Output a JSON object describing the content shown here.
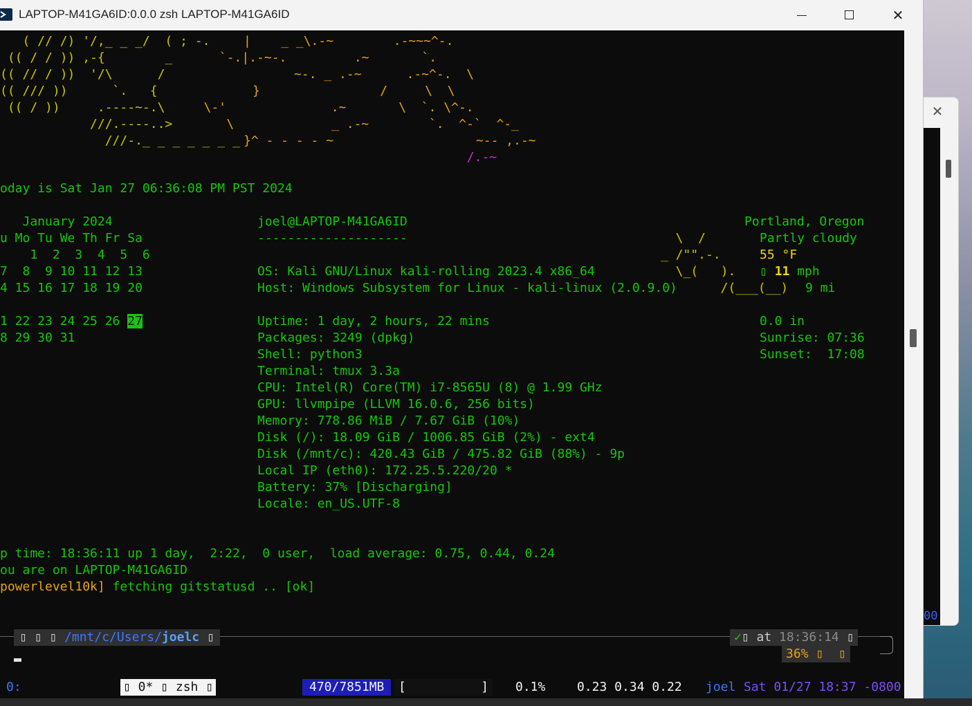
{
  "window": {
    "title": "LAPTOP-M41GA6ID:0.0.0 zsh LAPTOP-M41GA6ID",
    "minimize_label": "",
    "close_glyph": "✕"
  },
  "background_window": {
    "close_glyph": "✕",
    "text": "00"
  },
  "ascii_art": [
    {
      "cls": "y",
      "text": "   ( // /) '/,_ _ _/  ( ; -.   "
    },
    {
      "cls": "y",
      "text": " (( / / )) ,-{        _        "
    },
    {
      "cls": "y",
      "text": "(( // / ))  '/\\      /         "
    },
    {
      "cls": "y",
      "text": "(( /// ))      `.   {          "
    },
    {
      "cls": "y",
      "text": " (( / ))     .----~-.\\        "
    },
    {
      "cls": "y",
      "text": "            ///.----..>        "
    },
    {
      "cls": "y",
      "text": "              ///-._ _ _ _ _ _ _"
    }
  ],
  "ascii_art_o": [
    "|    _ _\\.-~        .-~~~^-.  ",
    " `-.|.-~-.         .~       `.",
    "      ~-. _ .-~      .-~^-.  \\",
    "      }                /     \\  \\",
    "   \\-'              .~       \\  `. \\^-.",
    "    \\             _ .-~        `.  ^-`  ^-_",
    "}^ - - - - ~                   ~-- ,.-~",
    "                                /.-~"
  ],
  "today_line": "oday is Sat Jan 27 06:36:08 PM PST 2024",
  "calendar": {
    "header": "   January 2024",
    "weekdays": "u Mo Tu We Th Fr Sa",
    "rows": [
      "    1  2  3  4  5  6",
      "7  8  9 10 11 12 13",
      "4 15 16 17 18 19 20",
      "",
      "1 22 23 24 25 26 ",
      "8 29 30 31"
    ],
    "today": "27"
  },
  "sysinfo": {
    "user_host": "joel@LAPTOP-M41GA6ID",
    "separator": "--------------------",
    "lines": [
      "",
      "OS: Kali GNU/Linux kali-rolling 2023.4 x86_64",
      "Host: Windows Subsystem for Linux - kali-linux (2.0.9.0)",
      "",
      "Uptime: 1 day, 2 hours, 22 mins",
      "Packages: 3249 (dpkg)",
      "Shell: python3",
      "Terminal: tmux 3.3a",
      "CPU: Intel(R) Core(TM) i7-8565U (8) @ 1.99 GHz",
      "GPU: llvmpipe (LLVM 16.0.6, 256 bits)",
      "Memory: 778.86 MiB / 7.67 GiB (10%)",
      "Disk (/): 18.09 GiB / 1006.85 GiB (2%) - ext4",
      "Disk (/mnt/c): 420.43 GiB / 475.82 GiB (88%) - 9p",
      "Local IP (eth0): 172.25.5.220/20 *",
      "Battery: 37% [Discharging]",
      "Locale: en_US.UTF-8"
    ]
  },
  "weather": {
    "location": "Portland, Oregon",
    "condition": "Partly cloudy",
    "temp": "55 °F",
    "wind_icon": "▯",
    "wind_speed": "11",
    "wind_unit": " mph",
    "visibility": "9 mi",
    "precip": "0.0 in",
    "sunrise": "Sunrise: 07:36",
    "sunset": "Sunset:  17:08",
    "art": [
      "  \\  /",
      "_ /\"\".-.",
      "  \\_(   ).",
      "  /(___(__)"
    ]
  },
  "footer_lines": [
    "p time: 18:36:11 up 1 day,  2:22,  0 user,  load average: 0.75, 0.44, 0.24",
    "ou are on LAPTOP-M41GA6ID"
  ],
  "p10k": {
    "bracket": "powerlevel10k]",
    "text": " fetching gitstatusd .. ",
    "ok": "[ok]"
  },
  "prompt": {
    "icons": "▯ ▯ ▯ ",
    "path_prefix": "/mnt/c/Users/",
    "path_current": "joelc",
    "end_icon": " ▯",
    "status_ok": "✓",
    "status_icons": "▯ ",
    "at": "at ",
    "time": "18:36:14",
    "time_icon": " ▯",
    "battery": "36%",
    "battery_icon": " ▯",
    "battery_icon2": "  ▯"
  },
  "tmux": {
    "index": "0:",
    "window": "▯ 0* ▯ zsh ▯",
    "memory": "470/7851MB",
    "bar": "[          ]",
    "cpu": "0.1%",
    "load": "0.23 0.34 0.22",
    "user": "joel",
    "date": "Sat 01/27 18:37 -0800"
  }
}
